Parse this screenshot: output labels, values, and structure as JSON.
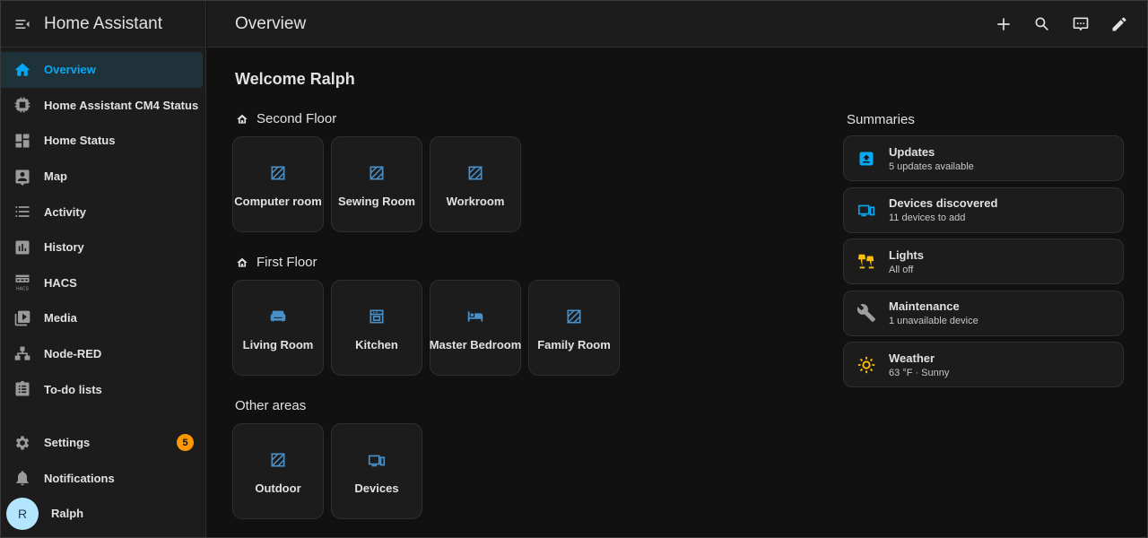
{
  "app": {
    "title": "Home Assistant"
  },
  "header": {
    "title": "Overview"
  },
  "sidebar": {
    "items": [
      {
        "label": "Overview",
        "icon": "home-icon"
      },
      {
        "label": "Home Assistant CM4 Status",
        "icon": "cpu-chip-icon"
      },
      {
        "label": "Home Status",
        "icon": "dashboard-icon"
      },
      {
        "label": "Map",
        "icon": "map-icon"
      },
      {
        "label": "Activity",
        "icon": "activity-list-icon"
      },
      {
        "label": "History",
        "icon": "history-chart-icon"
      },
      {
        "label": "HACS",
        "icon": "hacs-store-icon"
      },
      {
        "label": "Media",
        "icon": "media-icon"
      },
      {
        "label": "Node-RED",
        "icon": "sitemap-icon"
      },
      {
        "label": "To-do lists",
        "icon": "clipboard-list-icon"
      }
    ],
    "settings": {
      "label": "Settings",
      "badge": "5"
    },
    "notifications": {
      "label": "Notifications"
    },
    "user": {
      "label": "Ralph",
      "initial": "R"
    }
  },
  "main": {
    "welcome": "Welcome Ralph",
    "floors": [
      {
        "title": "Second Floor",
        "areas": [
          "Computer room",
          "Sewing Room",
          "Workroom"
        ]
      },
      {
        "title": "First Floor",
        "areas": [
          "Living Room",
          "Kitchen",
          "Master Bedroom",
          "Family Room"
        ]
      }
    ],
    "other": {
      "title": "Other areas",
      "areas": [
        "Outdoor",
        "Devices"
      ]
    },
    "summaries": {
      "title": "Summaries",
      "items": [
        {
          "name": "Updates",
          "sub": "5 updates available",
          "icon": "update-icon",
          "color": "#03a9f4"
        },
        {
          "name": "Devices discovered",
          "sub": "11 devices to add",
          "icon": "devices-icon",
          "color": "#03a9f4"
        },
        {
          "name": "Lights",
          "sub": "All off",
          "icon": "lamps-icon",
          "color": "#ffc107"
        },
        {
          "name": "Maintenance",
          "sub": "1 unavailable device",
          "icon": "wrench-icon",
          "color": "#9e9e9e"
        },
        {
          "name": "Weather",
          "sub": "63 °F · Sunny",
          "icon": "sun-icon",
          "color": "#ffc107"
        }
      ]
    }
  },
  "colors": {
    "accent": "#03a9f4",
    "badge": "#ff9800",
    "area_icon": "#4a90c8",
    "background": "#111111",
    "card": "#1c1c1c"
  }
}
